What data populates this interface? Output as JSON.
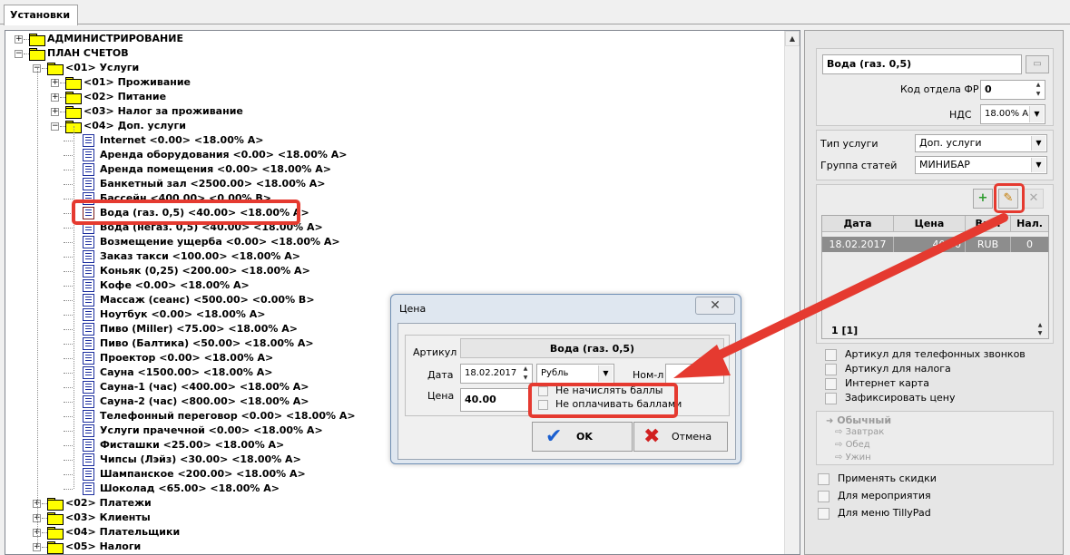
{
  "tab": {
    "label": "Установки"
  },
  "tree": {
    "rows": [
      {
        "label": "АДМИНИСТРИРОВАНИЕ",
        "kind": "folder",
        "expander": "+"
      },
      {
        "label": "ПЛАН СЧЕТОВ",
        "kind": "folder",
        "expander": "−"
      },
      {
        "label": "<01> Услуги",
        "kind": "folder",
        "expander": "−"
      },
      {
        "label": "<01> Проживание",
        "kind": "folder",
        "expander": "+"
      },
      {
        "label": "<02> Питание",
        "kind": "folder",
        "expander": "+"
      },
      {
        "label": "<03> Налог за проживание",
        "kind": "folder",
        "expander": "+"
      },
      {
        "label": "<04> Доп. услуги",
        "kind": "folder",
        "expander": "−"
      },
      {
        "label": "Internet  <0.00> <18.00% A>",
        "kind": "doc"
      },
      {
        "label": "Аренда оборудования  <0.00> <18.00% A>",
        "kind": "doc"
      },
      {
        "label": "Аренда помещения  <0.00> <18.00% A>",
        "kind": "doc"
      },
      {
        "label": "Банкетный зал  <2500.00> <18.00% A>",
        "kind": "doc"
      },
      {
        "label": "Бассейн  <400.00> <0.00% B>",
        "kind": "doc"
      },
      {
        "label": "Вода (газ. 0,5)  <40.00> <18.00% A>",
        "kind": "doc-edit"
      },
      {
        "label": "Вода (негаз. 0,5)  <40.00> <18.00% A>",
        "kind": "doc"
      },
      {
        "label": "Возмещение ущерба  <0.00> <18.00% A>",
        "kind": "doc"
      },
      {
        "label": "Заказ такси  <100.00> <18.00% A>",
        "kind": "doc"
      },
      {
        "label": "Коньяк (0,25)  <200.00> <18.00% A>",
        "kind": "doc"
      },
      {
        "label": "Кофе  <0.00> <18.00% A>",
        "kind": "doc"
      },
      {
        "label": "Массаж (сеанс)  <500.00> <0.00% B>",
        "kind": "doc"
      },
      {
        "label": "Ноутбук  <0.00> <18.00% A>",
        "kind": "doc"
      },
      {
        "label": "Пиво (Miller)  <75.00> <18.00% A>",
        "kind": "doc"
      },
      {
        "label": "Пиво (Балтика)  <50.00> <18.00% A>",
        "kind": "doc"
      },
      {
        "label": "Проектор  <0.00> <18.00% A>",
        "kind": "doc"
      },
      {
        "label": "Сауна  <1500.00> <18.00% A>",
        "kind": "doc"
      },
      {
        "label": "Сауна-1 (час)  <400.00> <18.00% A>",
        "kind": "doc"
      },
      {
        "label": "Сауна-2 (час)  <800.00> <18.00% A>",
        "kind": "doc"
      },
      {
        "label": "Телефонный переговор  <0.00> <18.00% A>",
        "kind": "doc"
      },
      {
        "label": "Услуги прачечной  <0.00> <18.00% A>",
        "kind": "doc"
      },
      {
        "label": "Фисташки  <25.00> <18.00% A>",
        "kind": "doc"
      },
      {
        "label": "Чипсы (Лэйз)  <30.00> <18.00% A>",
        "kind": "doc"
      },
      {
        "label": "Шампанское  <200.00> <18.00% A>",
        "kind": "doc"
      },
      {
        "label": "Шоколад  <65.00> <18.00% A>",
        "kind": "doc"
      },
      {
        "label": "<02> Платежи",
        "kind": "folder",
        "expander": "+"
      },
      {
        "label": "<03> Клиенты",
        "kind": "folder",
        "expander": "+"
      },
      {
        "label": "<04> Плательщики",
        "kind": "folder",
        "expander": "+"
      },
      {
        "label": "<05> Налоги",
        "kind": "folder",
        "expander": "+"
      }
    ]
  },
  "right": {
    "name_value": "Вода (газ. 0,5)",
    "dept_label": "Код отдела ФР",
    "dept_value": "0",
    "vat_label": "НДС",
    "vat_value": "18.00% A",
    "service_type_label": "Тип услуги",
    "service_type_value": "Доп. услуги",
    "group_label": "Группа статей",
    "group_value": "МИНИБАР",
    "grid": {
      "headers": [
        "Дата",
        "Цена",
        "Вал.",
        "Нал."
      ],
      "row": [
        "18.02.2017",
        "40.00",
        "RUB",
        "0"
      ],
      "footer": "1 [1]"
    },
    "checks": [
      "Артикул для телефонных звонков",
      "Артикул для налога",
      "Интернет карта",
      "Зафиксировать цену"
    ],
    "meal_header": "Обычный",
    "meals": [
      "Завтрак",
      "Обед",
      "Ужин"
    ],
    "bottom_checks": [
      "Применять скидки",
      "Для мероприятия",
      "Для меню TillyPad"
    ]
  },
  "dialog": {
    "title": "Цена",
    "article_label": "Артикул",
    "article_value": "Вода (газ. 0,5)",
    "date_label": "Дата",
    "date_value": "18.02.2017",
    "currency_value": "Рубль",
    "nom_label": "Ном-л",
    "price_label": "Цена",
    "price_value": "40.00",
    "check1": "Не начислять баллы",
    "check2": "Не оплачивать баллами",
    "ok_label": "OK",
    "cancel_label": "Отмена"
  },
  "colors": {
    "highlight": "#e53a30",
    "accent_check": "#1a5fd0",
    "cancel_x": "#d12020"
  },
  "icons": [
    "folder-icon",
    "document-icon",
    "add-icon",
    "edit-icon",
    "delete-icon",
    "check-icon",
    "cancel-icon",
    "close-icon"
  ]
}
